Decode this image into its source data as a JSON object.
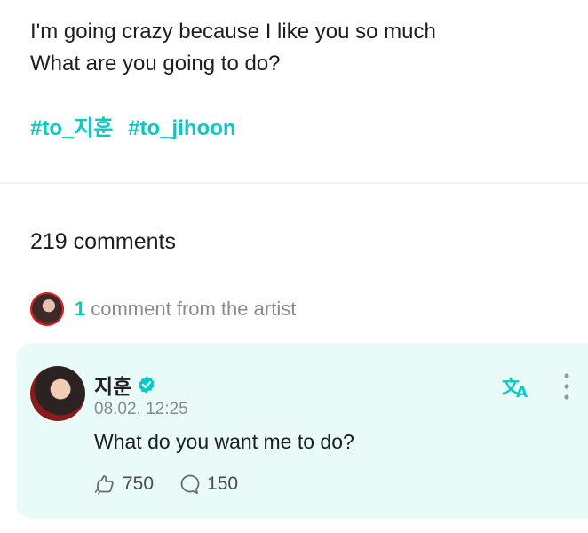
{
  "post": {
    "lines": [
      "I'm going crazy because I like you so much",
      "What are you going to do?"
    ],
    "hashtags": [
      "#to_지훈",
      "#to_jihoon"
    ]
  },
  "comments": {
    "count_label": "219 comments",
    "artist_count": "1",
    "artist_label": "comment from the artist"
  },
  "comment": {
    "author": "지훈",
    "timestamp": "08.02. 12:25",
    "text": "What do you want me to do?",
    "likes": "750",
    "replies": "150"
  },
  "colors": {
    "accent": "#08c9c4",
    "card_background": "#e9fbf8"
  },
  "icons": [
    "verified-badge-icon",
    "translate-icon",
    "more-vertical-icon",
    "like-icon",
    "reply-icon"
  ]
}
